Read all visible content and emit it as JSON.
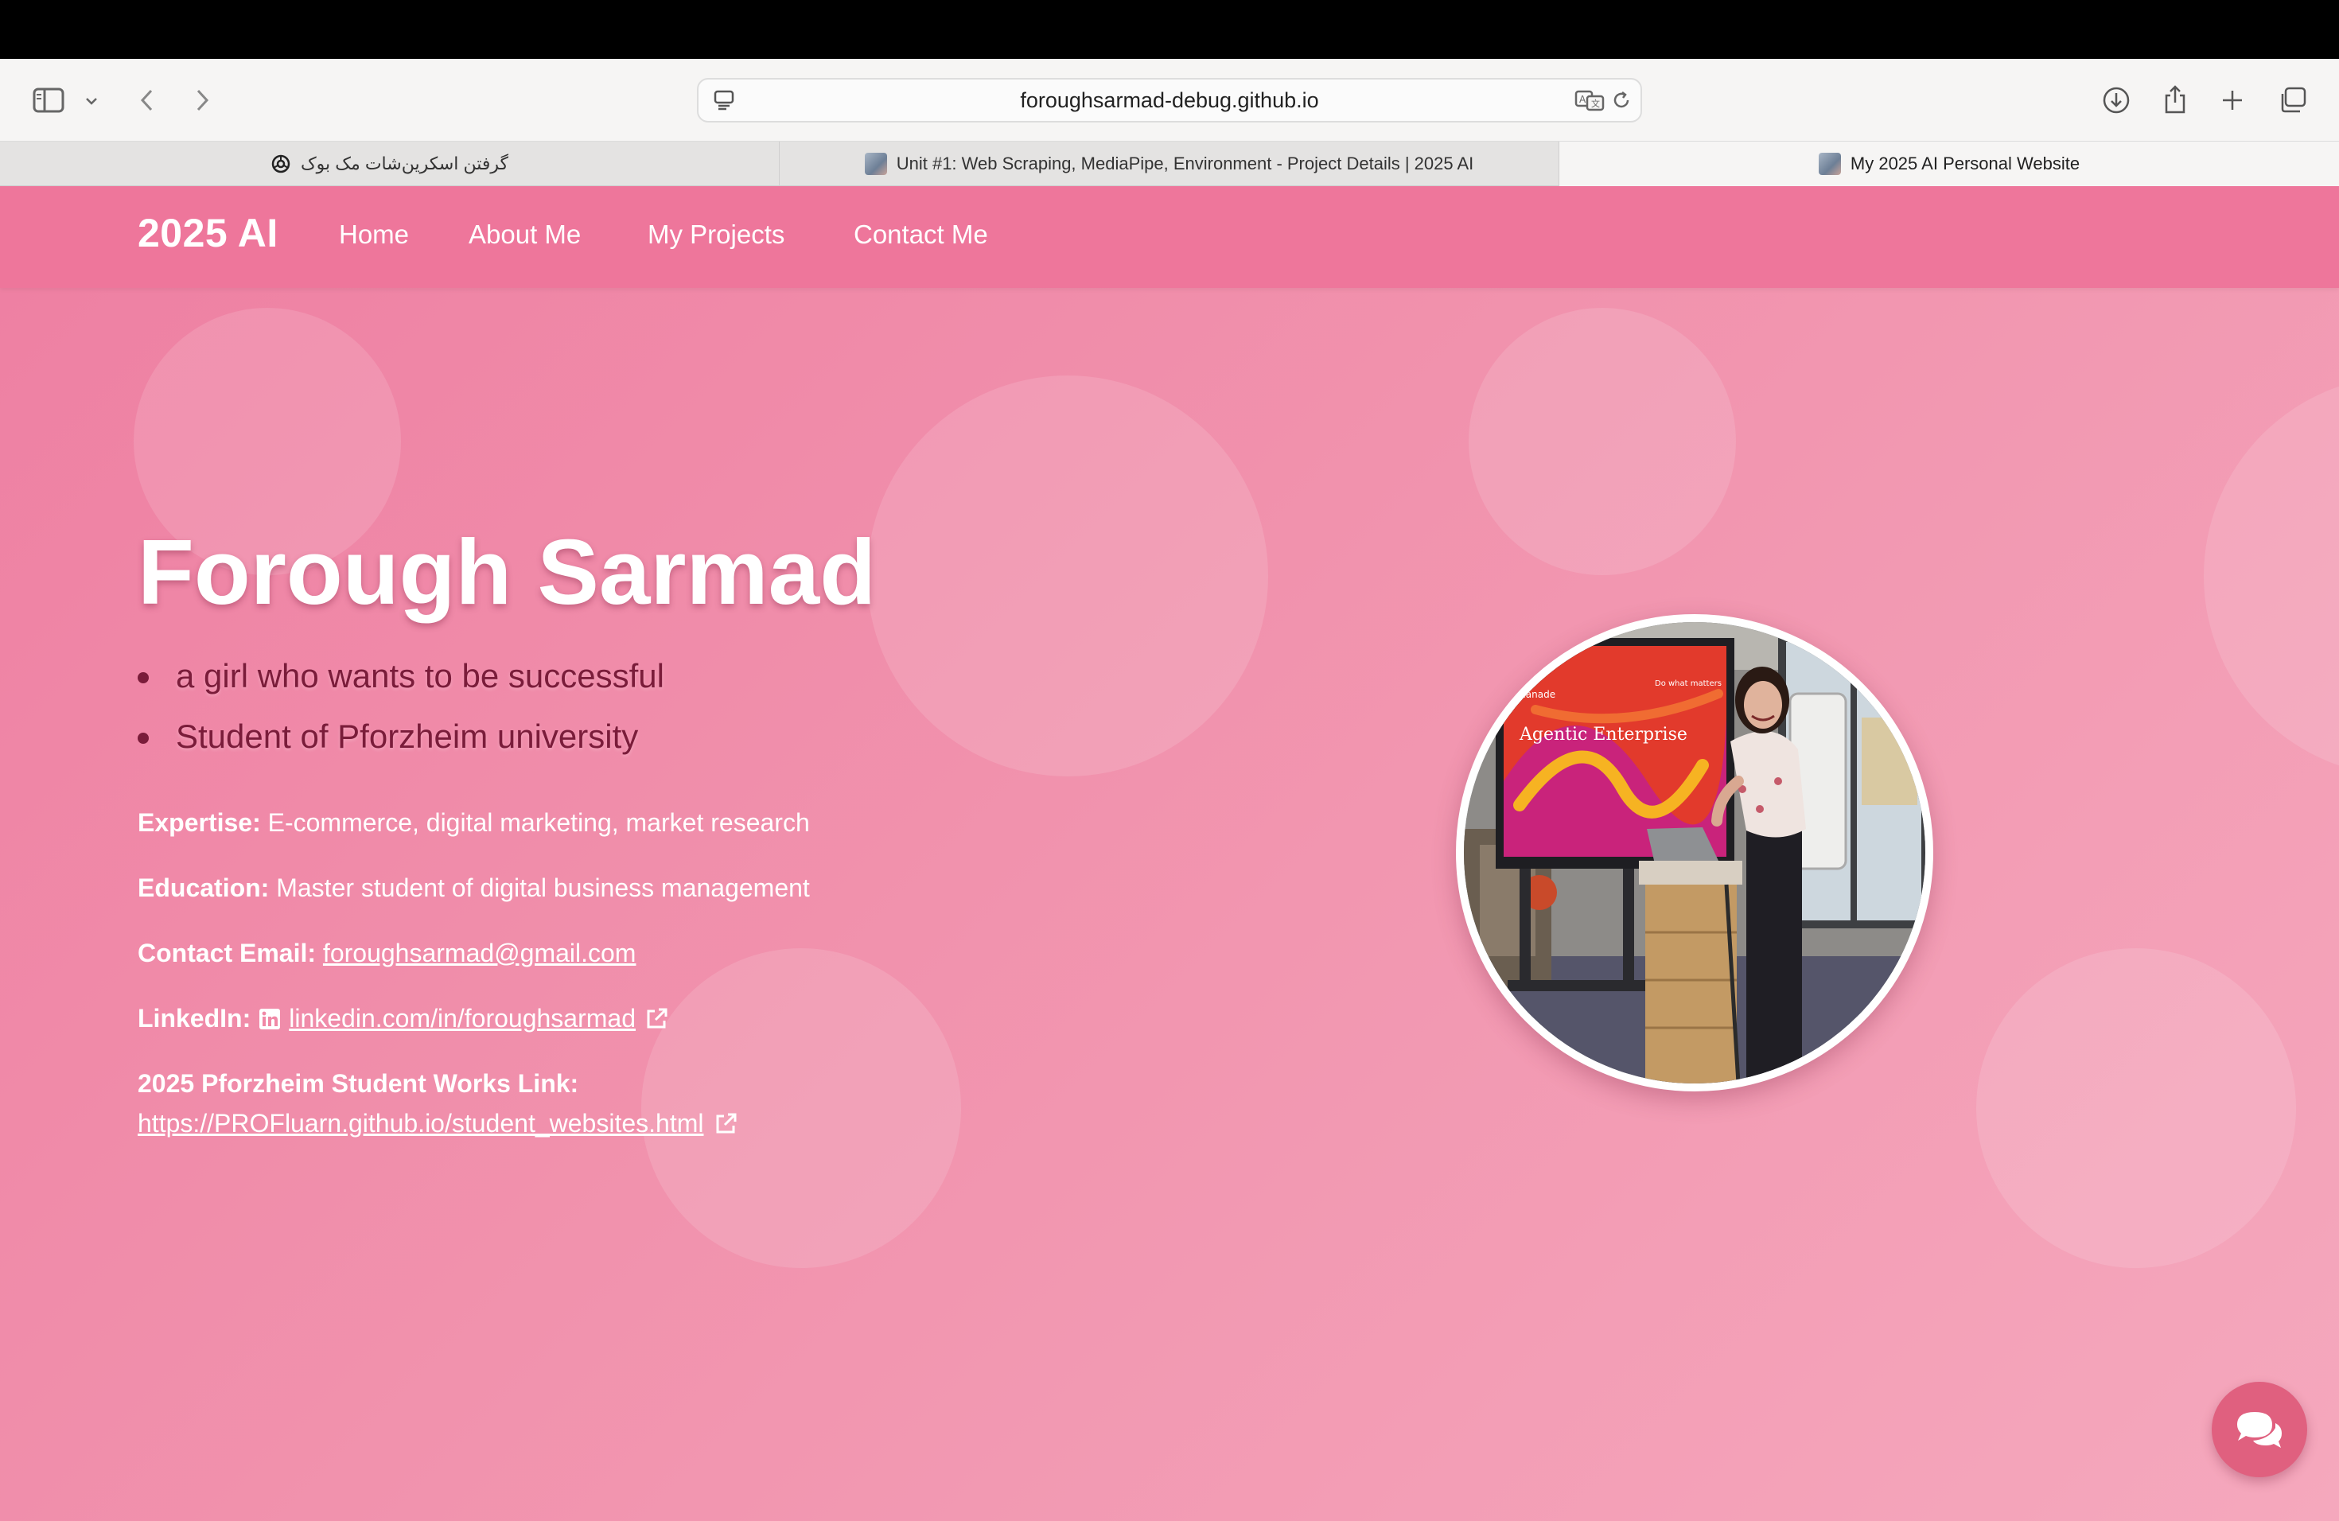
{
  "browser": {
    "url": "foroughsarmad-debug.github.io",
    "tabs": [
      {
        "label": "گرفتن اسکرین‌شات مک بوک",
        "active": false
      },
      {
        "label": "Unit #1: Web Scraping, MediaPipe, Environment - Project Details | 2025 AI",
        "active": false
      },
      {
        "label": "My 2025 AI Personal Website",
        "active": true
      }
    ]
  },
  "site": {
    "brand": "2025 AI",
    "nav": [
      "Home",
      "About Me",
      "My Projects",
      "Contact Me"
    ]
  },
  "hero": {
    "name": "Forough Sarmad",
    "taglines": [
      "a girl who wants to be successful",
      "Student of Pforzheim university"
    ],
    "expertise_label": "Expertise:",
    "expertise_value": "E-commerce, digital marketing, market research",
    "education_label": "Education:",
    "education_value": "Master student of digital business management",
    "email_label": "Contact Email:",
    "email_value": "foroughsarmad@gmail.com",
    "linkedin_label": "LinkedIn:",
    "linkedin_value": "linkedin.com/in/foroughsarmad",
    "works_label": "2025 Pforzheim Student Works Link:",
    "works_value": "https://PROFluarn.github.io/student_websites.html"
  },
  "photo": {
    "slide_title": "Agentic Enterprise",
    "slide_company": "valanade",
    "slide_tagline": "Do what matters"
  },
  "colors": {
    "nav_bg": "#ee769b",
    "tagline_text": "#7a1c3a",
    "chat_button": "#e0607f"
  }
}
